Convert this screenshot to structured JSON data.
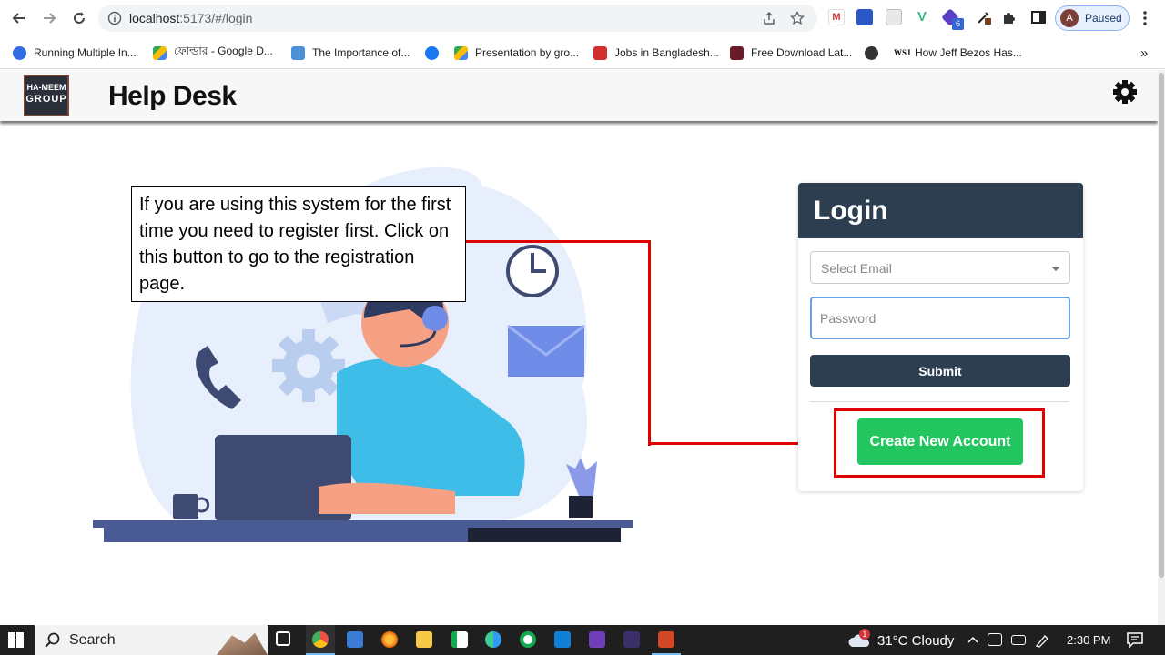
{
  "browser": {
    "url_host": "localhost",
    "url_path": ":5173/#/login",
    "profile_initial": "A",
    "profile_status": "Paused",
    "extension_badge": "6",
    "bookmarks": [
      {
        "label": "Running Multiple In...",
        "color": "#326ce5"
      },
      {
        "label": "ফোল্ডার - Google D...",
        "color": "#fbbc04"
      },
      {
        "label": "The Importance of...",
        "color": "#4a90d9"
      },
      {
        "label": "",
        "color": "#1877f2"
      },
      {
        "label": "Presentation by gro...",
        "color": "#34a853"
      },
      {
        "label": "Jobs in Bangladesh...",
        "color": "#d32f2f"
      },
      {
        "label": "Free Download Lat...",
        "color": "#6a1b2a"
      },
      {
        "label": "",
        "color": "#333333"
      },
      {
        "label": "How Jeff Bezos Has...",
        "color": "#111111"
      }
    ],
    "more_bookmarks": "»"
  },
  "app": {
    "logo_line1": "HA-MEEM",
    "logo_line2": "GROUP",
    "title": "Help Desk"
  },
  "callout": {
    "text": "If you are using this system for the first time you need to register first. Click on this button to go to the registration page."
  },
  "login": {
    "title": "Login",
    "email_placeholder": "Select Email",
    "password_placeholder": "Password",
    "submit_label": "Submit",
    "create_label": "Create New Account"
  },
  "taskbar": {
    "search_label": "Search",
    "weather": "31°C  Cloudy",
    "weather_badge": "1",
    "time": "2:30 PM"
  },
  "colors": {
    "primary": "#2c3e50",
    "success": "#22c55e",
    "annotation": "#e00000"
  }
}
